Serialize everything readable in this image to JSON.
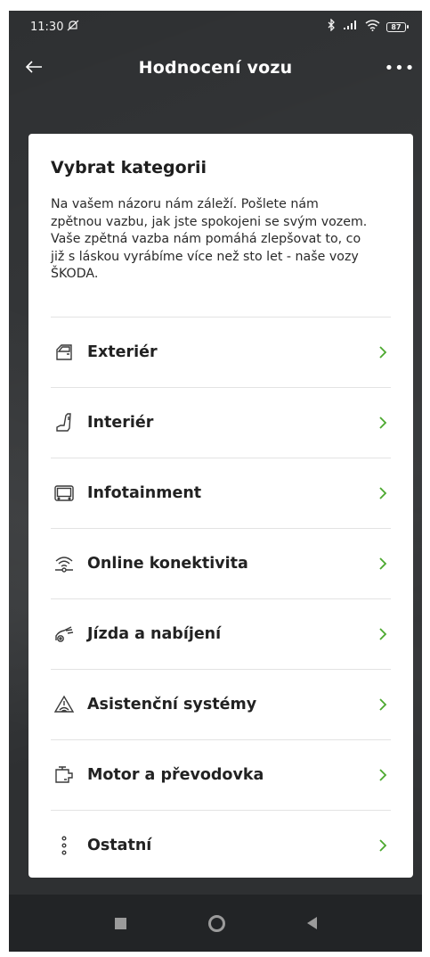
{
  "status_bar": {
    "time": "11:30",
    "battery": "87",
    "icons": [
      "mute-icon",
      "bluetooth-icon",
      "signal-icon",
      "wifi-icon",
      "battery-icon"
    ]
  },
  "app_bar": {
    "title": "Hodnocení vozu",
    "back_icon": "arrow-left-icon",
    "more_icon": "more-horizontal-icon",
    "more_label": "•••"
  },
  "card": {
    "title": "Vybrat kategorii",
    "description": "Na vašem názoru nám záleží. Pošlete nám zpětnou vazbu, jak jste spokojeni se svým vozem. Vaše zpětná vazba nám pomáhá zlepšovat to, co již s láskou vyrábíme více než sto let - naše vozy ŠKODA.",
    "accent_color": "#4ba82e",
    "categories": [
      {
        "label": "Exteriér",
        "icon": "car-door-icon"
      },
      {
        "label": "Interiér",
        "icon": "car-seat-icon"
      },
      {
        "label": "Infotainment",
        "icon": "infotainment-screen-icon"
      },
      {
        "label": "Online konektivita",
        "icon": "connectivity-icon"
      },
      {
        "label": "Jízda a nabíjení",
        "icon": "driving-charging-icon"
      },
      {
        "label": "Asistenční systémy",
        "icon": "assistance-warning-icon"
      },
      {
        "label": "Motor a převodovka",
        "icon": "engine-icon"
      },
      {
        "label": "Ostatní",
        "icon": "more-vertical-icon"
      }
    ]
  },
  "nav_bar": {
    "icons": [
      "recent-apps-icon",
      "home-icon",
      "back-icon"
    ]
  }
}
